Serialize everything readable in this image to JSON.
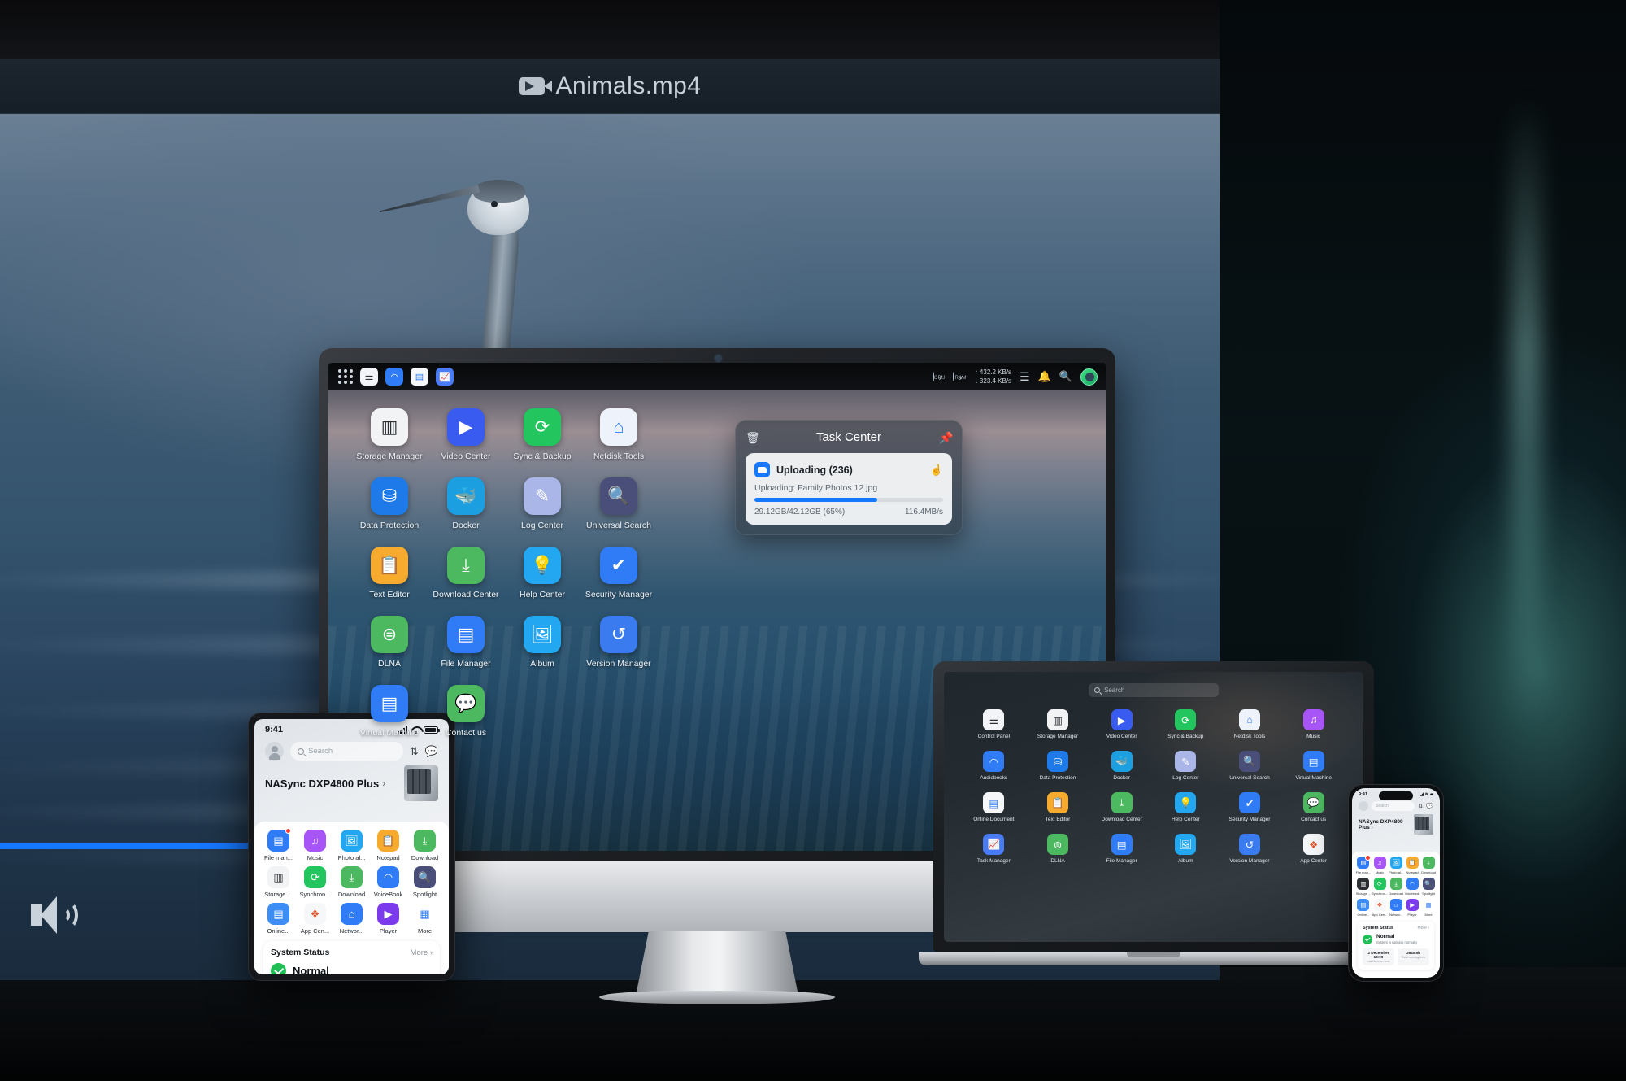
{
  "tv": {
    "title": "Animals.mp4",
    "title_icon": "video-camera-icon",
    "progress_percent": 72,
    "volume_icon": "volume-on-icon",
    "accent_color": "#1677ff"
  },
  "desktop": {
    "dock_icons": [
      {
        "name": "app-launcher-icon",
        "glyph": "grid"
      },
      {
        "name": "control-panel-icon",
        "glyph": "sliders",
        "color": "#f2f4f7"
      },
      {
        "name": "audiobooks-icon",
        "glyph": "headphones",
        "color": "#2f7cf6"
      },
      {
        "name": "online-document-icon",
        "glyph": "document",
        "color": "#3c8df5"
      },
      {
        "name": "task-manager-icon",
        "glyph": "chart-line",
        "color": "#4a7bf7"
      }
    ],
    "statusbar": {
      "cpu_label": "CPU",
      "ram_label": "RAM",
      "upload_rate": "432.2 KB/s",
      "download_rate": "323.4 KB/s",
      "list_icon": "list-icon",
      "bell_icon": "bell-icon",
      "search_icon": "search-icon",
      "avatar_icon": "avatar-icon"
    },
    "apps": [
      {
        "label": "Storage Manager",
        "icon": "storage-manager-icon",
        "color": "#f2f3f5",
        "glyph": "▥",
        "fg": "#2b2f33"
      },
      {
        "label": "Video Center",
        "icon": "video-center-icon",
        "color": "#3a5bef",
        "glyph": "▶",
        "fg": "#ffffff"
      },
      {
        "label": "Sync & Backup",
        "icon": "sync-backup-icon",
        "color": "#22c55e",
        "glyph": "⟳",
        "fg": "#ffffff"
      },
      {
        "label": "Netdisk Tools",
        "icon": "netdisk-tools-icon",
        "color": "#eef2fb",
        "glyph": "⌂",
        "fg": "#2f7cf6"
      },
      {
        "label": "Data Protection",
        "icon": "data-protection-icon",
        "color": "#1e7ae8",
        "glyph": "⛁",
        "fg": "#ffffff"
      },
      {
        "label": "Docker",
        "icon": "docker-icon",
        "color": "#1b9fe0",
        "glyph": "🐳",
        "fg": "#ffffff"
      },
      {
        "label": "Log Center",
        "icon": "log-center-icon",
        "color": "#aab6e8",
        "glyph": "✎",
        "fg": "#ffffff"
      },
      {
        "label": "Universal Search",
        "icon": "universal-search-icon",
        "color": "#4a4f7a",
        "glyph": "🔍",
        "fg": "#ffffff"
      },
      {
        "label": "Text Editor",
        "icon": "text-editor-icon",
        "color": "#f6ab2f",
        "glyph": "📋",
        "fg": "#ffffff"
      },
      {
        "label": "Download Center",
        "icon": "download-center-icon",
        "color": "#4cb860",
        "glyph": "⤓",
        "fg": "#ffffff"
      },
      {
        "label": "Help Center",
        "icon": "help-center-icon",
        "color": "#22a7f0",
        "glyph": "💡",
        "fg": "#ffffff"
      },
      {
        "label": "Security Manager",
        "icon": "security-manager-icon",
        "color": "#2f7cf6",
        "glyph": "✔",
        "fg": "#ffffff"
      },
      {
        "label": "DLNA",
        "icon": "dlna-icon",
        "color": "#4cb860",
        "glyph": "⊜",
        "fg": "#ffffff"
      },
      {
        "label": "File Manager",
        "icon": "file-manager-icon",
        "color": "#2f7cf6",
        "glyph": "▤",
        "fg": "#ffffff"
      },
      {
        "label": "Album",
        "icon": "album-icon",
        "color": "#22a7f0",
        "glyph": "🖼",
        "fg": "#ffffff"
      },
      {
        "label": "Version Manager",
        "icon": "version-manager-icon",
        "color": "#3a7bf0",
        "glyph": "↺",
        "fg": "#ffffff"
      },
      {
        "label": "Virtual Machine",
        "icon": "virtual-machine-icon",
        "color": "#2f7cf6",
        "glyph": "▤",
        "fg": "#ffffff"
      },
      {
        "label": "Contact us",
        "icon": "contact-us-icon",
        "color": "#4cb860",
        "glyph": "💬",
        "fg": "#ffffff"
      }
    ],
    "task_center": {
      "title": "Task Center",
      "clear_icon": "clear-tasks-icon",
      "pin_icon": "pin-icon",
      "task_name": "Uploading (236)",
      "task_detail": "Uploading: Family Photos 12.jpg",
      "progress_text": "29.12GB/42.12GB (65%)",
      "speed": "116.4MB/s",
      "progress_percent": 65,
      "cursor_icon": "pointer-cursor-icon",
      "app_icon": "file-manager-icon"
    }
  },
  "tablet": {
    "time": "9:41",
    "search_placeholder": "Search",
    "avatar_icon": "avatar-icon",
    "transfer_icon": "transfer-icon",
    "chat_icon": "chat-icon",
    "device_name": "NASync DXP4800 Plus",
    "device_chevron": "›",
    "nas_icon": "nas-device-icon",
    "apps": [
      {
        "label": "File man...",
        "icon": "file-manager-icon",
        "color": "#2f7cf6",
        "glyph": "▤",
        "badge": true
      },
      {
        "label": "Music",
        "icon": "music-icon",
        "color": "#a855f7",
        "glyph": "♫",
        "badge": false
      },
      {
        "label": "Photo al...",
        "icon": "photo-album-icon",
        "color": "#22a7f0",
        "glyph": "🖼",
        "badge": false
      },
      {
        "label": "Notepad",
        "icon": "notepad-icon",
        "color": "#f6ab2f",
        "glyph": "📋",
        "badge": false
      },
      {
        "label": "Download",
        "icon": "download-icon",
        "color": "#4cb860",
        "glyph": "⤓",
        "badge": false
      },
      {
        "label": "Storage ...",
        "icon": "storage-manager-icon",
        "color": "#f2f3f5",
        "glyph": "▥",
        "fg": "#2b2f33",
        "badge": false
      },
      {
        "label": "Synchron...",
        "icon": "sync-backup-icon",
        "color": "#22c55e",
        "glyph": "⟳",
        "badge": false
      },
      {
        "label": "Download",
        "icon": "download-icon",
        "color": "#4cb860",
        "glyph": "⤓",
        "badge": false
      },
      {
        "label": "VoiceBook",
        "icon": "voicebook-icon",
        "color": "#2f7cf6",
        "glyph": "◠",
        "badge": false
      },
      {
        "label": "Spotlight",
        "icon": "spotlight-icon",
        "color": "#4a4f7a",
        "glyph": "🔍",
        "badge": false
      },
      {
        "label": "Online...",
        "icon": "online-document-icon",
        "color": "#3c8df5",
        "glyph": "▤",
        "badge": false
      },
      {
        "label": "App Cen...",
        "icon": "app-center-icon",
        "color": "#f6f7f9",
        "glyph": "❖",
        "fg": "#e0542b",
        "badge": false
      },
      {
        "label": "Networ...",
        "icon": "network-icon",
        "color": "#2f7cf6",
        "glyph": "⌂",
        "badge": false
      },
      {
        "label": "Player",
        "icon": "player-icon",
        "color": "#7c3aed",
        "glyph": "▶",
        "badge": false
      },
      {
        "label": "More",
        "icon": "more-icon",
        "color": "#ffffff",
        "glyph": "▦",
        "fg": "#2f7cf6",
        "badge": false
      }
    ],
    "system_status": {
      "title": "System Status",
      "more_label": "More",
      "more_chevron": "›",
      "state": "Normal",
      "check_icon": "check-circle-icon"
    }
  },
  "laptop": {
    "search_placeholder": "Search",
    "search_icon": "search-icon",
    "apps": [
      {
        "label": "Control Panel",
        "icon": "control-panel-icon",
        "color": "#f2f4f7",
        "glyph": "⚌",
        "fg": "#2b2f33"
      },
      {
        "label": "Storage Manager",
        "icon": "storage-manager-icon",
        "color": "#f2f3f5",
        "glyph": "▥",
        "fg": "#2b2f33"
      },
      {
        "label": "Video Center",
        "icon": "video-center-icon",
        "color": "#3a5bef",
        "glyph": "▶"
      },
      {
        "label": "Sync & Backup",
        "icon": "sync-backup-icon",
        "color": "#22c55e",
        "glyph": "⟳"
      },
      {
        "label": "Netdisk Tools",
        "icon": "netdisk-tools-icon",
        "color": "#eef2fb",
        "glyph": "⌂",
        "fg": "#2f7cf6"
      },
      {
        "label": "Music",
        "icon": "music-icon",
        "color": "#a855f7",
        "glyph": "♫"
      },
      {
        "label": "Audiobooks",
        "icon": "audiobooks-icon",
        "color": "#2f7cf6",
        "glyph": "◠"
      },
      {
        "label": "Data Protection",
        "icon": "data-protection-icon",
        "color": "#1e7ae8",
        "glyph": "⛁"
      },
      {
        "label": "Docker",
        "icon": "docker-icon",
        "color": "#1b9fe0",
        "glyph": "🐳"
      },
      {
        "label": "Log Center",
        "icon": "log-center-icon",
        "color": "#aab6e8",
        "glyph": "✎"
      },
      {
        "label": "Universal Search",
        "icon": "universal-search-icon",
        "color": "#4a4f7a",
        "glyph": "🔍"
      },
      {
        "label": "Virtual Machine",
        "icon": "virtual-machine-icon",
        "color": "#2f7cf6",
        "glyph": "▤"
      },
      {
        "label": "Online Document",
        "icon": "online-document-icon",
        "color": "#f6f7f9",
        "glyph": "▤",
        "fg": "#2f7cf6"
      },
      {
        "label": "Text Editor",
        "icon": "text-editor-icon",
        "color": "#f6ab2f",
        "glyph": "📋"
      },
      {
        "label": "Download Center",
        "icon": "download-center-icon",
        "color": "#4cb860",
        "glyph": "⤓"
      },
      {
        "label": "Help Center",
        "icon": "help-center-icon",
        "color": "#22a7f0",
        "glyph": "💡"
      },
      {
        "label": "Security Manager",
        "icon": "security-manager-icon",
        "color": "#2f7cf6",
        "glyph": "✔"
      },
      {
        "label": "Contact us",
        "icon": "contact-us-icon",
        "color": "#4cb860",
        "glyph": "💬"
      },
      {
        "label": "Task Manager",
        "icon": "task-manager-icon",
        "color": "#4a7bf7",
        "glyph": "📈"
      },
      {
        "label": "DLNA",
        "icon": "dlna-icon",
        "color": "#4cb860",
        "glyph": "⊜"
      },
      {
        "label": "File Manager",
        "icon": "file-manager-icon",
        "color": "#2f7cf6",
        "glyph": "▤"
      },
      {
        "label": "Album",
        "icon": "album-icon",
        "color": "#22a7f0",
        "glyph": "🖼"
      },
      {
        "label": "Version Manager",
        "icon": "version-manager-icon",
        "color": "#3a7bf0",
        "glyph": "↺"
      },
      {
        "label": "App Center",
        "icon": "app-center-icon",
        "color": "#f6f7f9",
        "glyph": "❖",
        "fg": "#e0542b"
      }
    ]
  },
  "phone": {
    "time": "9:41",
    "search_placeholder": "Search",
    "device_name": "NASync DXP4800 Plus",
    "device_chevron": "›",
    "apps": [
      {
        "label": "File man...",
        "icon": "file-manager-icon",
        "color": "#2f7cf6",
        "glyph": "▤",
        "badge": true
      },
      {
        "label": "Music",
        "icon": "music-icon",
        "color": "#a855f7",
        "glyph": "♫"
      },
      {
        "label": "Photo al...",
        "icon": "photo-album-icon",
        "color": "#22a7f0",
        "glyph": "🖼"
      },
      {
        "label": "Notepad",
        "icon": "notepad-icon",
        "color": "#f6ab2f",
        "glyph": "📋"
      },
      {
        "label": "Download",
        "icon": "download-icon",
        "color": "#4cb860",
        "glyph": "⤓"
      },
      {
        "label": "Storage ...",
        "icon": "storage-manager-icon",
        "color": "#2b2f33",
        "glyph": "▥"
      },
      {
        "label": "Synchron...",
        "icon": "sync-backup-icon",
        "color": "#22c55e",
        "glyph": "⟳"
      },
      {
        "label": "Download",
        "icon": "download-icon",
        "color": "#4cb860",
        "glyph": "⤓"
      },
      {
        "label": "Voicebook",
        "icon": "voicebook-icon",
        "color": "#2f7cf6",
        "glyph": "◠"
      },
      {
        "label": "Spotlight",
        "icon": "spotlight-icon",
        "color": "#4a4f7a",
        "glyph": "🔍"
      },
      {
        "label": "Online...",
        "icon": "online-document-icon",
        "color": "#3c8df5",
        "glyph": "▤"
      },
      {
        "label": "App Cen...",
        "icon": "app-center-icon",
        "color": "#f6f7f9",
        "glyph": "❖",
        "fg": "#e0542b"
      },
      {
        "label": "Networ...",
        "icon": "network-icon",
        "color": "#2f7cf6",
        "glyph": "⌂"
      },
      {
        "label": "Player",
        "icon": "player-icon",
        "color": "#7c3aed",
        "glyph": "▶"
      },
      {
        "label": "More",
        "icon": "more-icon",
        "color": "#ffffff",
        "glyph": "▦",
        "fg": "#2f7cf6"
      }
    ],
    "system_status": {
      "title": "System Status",
      "more_label": "More",
      "more_chevron": "›",
      "state": "Normal",
      "description": "System is running normally",
      "stats": [
        {
          "value": "2 December 13:00",
          "key": "Last turn on time"
        },
        {
          "value": "2640.5h",
          "key": "Total running time"
        }
      ]
    }
  }
}
